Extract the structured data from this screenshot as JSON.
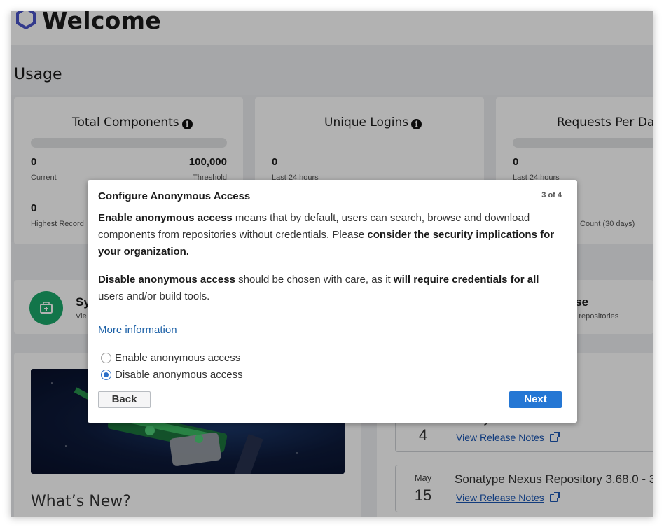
{
  "header": {
    "title": "Welcome"
  },
  "usage": {
    "title": "Usage",
    "cards": [
      {
        "title": "Total Components",
        "value": "0",
        "value_label": "Current",
        "threshold": "100,000",
        "threshold_label": "Threshold",
        "secondary_value": "0",
        "secondary_label": "Highest Record"
      },
      {
        "title": "Unique Logins",
        "value": "0",
        "value_label": "Last 24 hours"
      },
      {
        "title": "Requests Per Day",
        "value": "0",
        "value_label": "Last 24 hours",
        "secondary_label": "Count (30 days)"
      }
    ]
  },
  "system_card": {
    "title": "Sy",
    "subtitle": "Vie"
  },
  "browse_card": {
    "title": "wse",
    "subtitle": "se my repositories"
  },
  "whats_new": {
    "title": "What’s New?"
  },
  "releases": [
    {
      "month": "",
      "day": "4",
      "title": "ository 3.69.0",
      "link": "View Release Notes"
    },
    {
      "month": "May",
      "day": "15",
      "title": "Sonatype Nexus Repository 3.68.0 - 3.6",
      "link": "View Release Notes"
    }
  ],
  "modal": {
    "title": "Configure Anonymous Access",
    "step": "3 of 4",
    "p1_bold1": "Enable anonymous access",
    "p1_text1": " means that by default, users can search, browse and download components from repositories without credentials. Please ",
    "p1_bold2": "consider the security implications for your organization.",
    "p2_bold1": "Disable anonymous access",
    "p2_text1": " should be chosen with care, as it ",
    "p2_bold2": "will require credentials for all",
    "p2_text2": " users and/or build tools.",
    "more_link": "More information",
    "options": [
      {
        "label": "Enable anonymous access",
        "checked": false
      },
      {
        "label": "Disable anonymous access",
        "checked": true
      }
    ],
    "back_label": "Back",
    "next_label": "Next"
  },
  "colors": {
    "primary": "#2577d4",
    "link": "#1a5fa6",
    "green": "#1ba86b",
    "overlay": "rgba(0,0,0,0.30)"
  }
}
